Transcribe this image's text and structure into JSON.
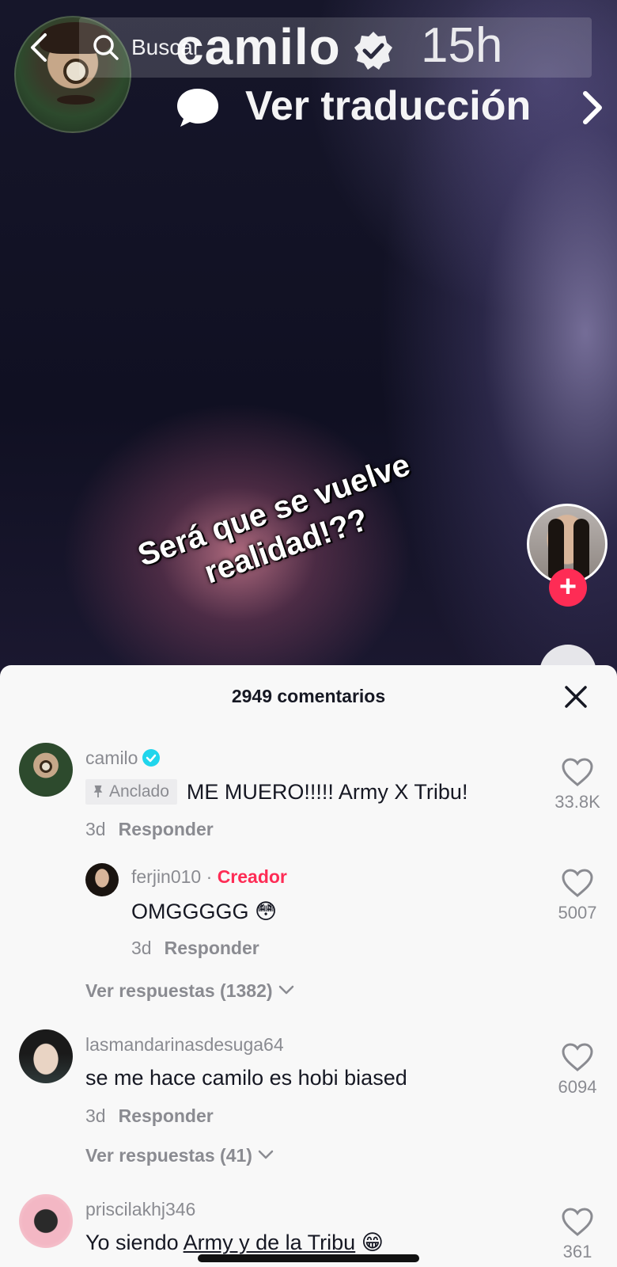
{
  "top": {
    "search_placeholder": "Buscar",
    "overlay_username": "camilo",
    "overlay_time": "15h",
    "translate_label": "Ver traducción"
  },
  "video": {
    "caption_line1": "Será que se vuelve",
    "caption_line2": "realidad!??"
  },
  "sheet": {
    "title": "2949 comentarios"
  },
  "comments": [
    {
      "username": "camilo",
      "pinned_label": "Anclado",
      "text": "ME MUERO!!!!! Army X Tribu!",
      "time": "3d",
      "reply_label": "Responder",
      "likes": "33.8K"
    },
    {
      "username": "ferjin010",
      "separator": "·",
      "creator_label": "Creador",
      "text": "OMGGGGG",
      "emoji": "😳",
      "time": "3d",
      "reply_label": "Responder",
      "likes": "5007"
    },
    {
      "view_replies": "Ver respuestas (1382)"
    },
    {
      "username": "lasmandarinasdesuga64",
      "text": "se me hace camilo es hobi biased",
      "time": "3d",
      "reply_label": "Responder",
      "likes": "6094"
    },
    {
      "view_replies": "Ver respuestas (41)"
    },
    {
      "username": "priscilakhj346",
      "text_prefix": "Yo siendo ",
      "text_underlined": "Army y de la Tribu",
      "emoji": "😁",
      "likes": "361"
    }
  ],
  "colors": {
    "accent_red": "#fe2c55",
    "verified_blue": "#20d5ec",
    "muted_text": "#8a8b91",
    "primary_text": "#161823"
  }
}
